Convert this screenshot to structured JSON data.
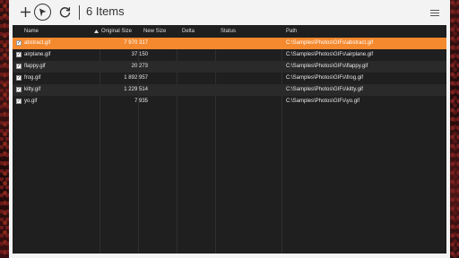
{
  "toolbar": {
    "add_icon": "plus-icon",
    "run_icon": "play-icon",
    "refresh_icon": "refresh-icon",
    "title": "6 Items",
    "menu_icon": "hamburger-menu-icon"
  },
  "columns": {
    "name": "Name",
    "original_size": "Original Size",
    "new_size": "New Size",
    "delta": "Delta",
    "status": "Status",
    "path": "Path"
  },
  "rows": [
    {
      "name": "abstract.gif",
      "original_size": "7 970 317",
      "new_size": "",
      "delta": "",
      "status": "",
      "path": "C:\\Samples\\Photos\\GIFs\\abstract.gif",
      "checked": true,
      "selected": true
    },
    {
      "name": "airplane.gif",
      "original_size": "37 150",
      "new_size": "",
      "delta": "",
      "status": "",
      "path": "C:\\Samples\\Photos\\GIFs\\airplane.gif",
      "checked": true,
      "selected": false
    },
    {
      "name": "flappy.gif",
      "original_size": "20 273",
      "new_size": "",
      "delta": "",
      "status": "",
      "path": "C:\\Samples\\Photos\\GIFs\\flappy.gif",
      "checked": true,
      "selected": false
    },
    {
      "name": "frog.gif",
      "original_size": "1 892 957",
      "new_size": "",
      "delta": "",
      "status": "",
      "path": "C:\\Samples\\Photos\\GIFs\\frog.gif",
      "checked": true,
      "selected": false
    },
    {
      "name": "kitty.gif",
      "original_size": "1 229 514",
      "new_size": "",
      "delta": "",
      "status": "",
      "path": "C:\\Samples\\Photos\\GIFs\\kitty.gif",
      "checked": true,
      "selected": false
    },
    {
      "name": "yo.gif",
      "original_size": "7 935",
      "new_size": "",
      "delta": "",
      "status": "",
      "path": "C:\\Samples\\Photos\\GIFs\\yo.gif",
      "checked": true,
      "selected": false
    }
  ],
  "colors": {
    "selection": "#f5892e",
    "grid_background": "#1f1f1f",
    "toolbar_background": "#f3f3f3"
  }
}
